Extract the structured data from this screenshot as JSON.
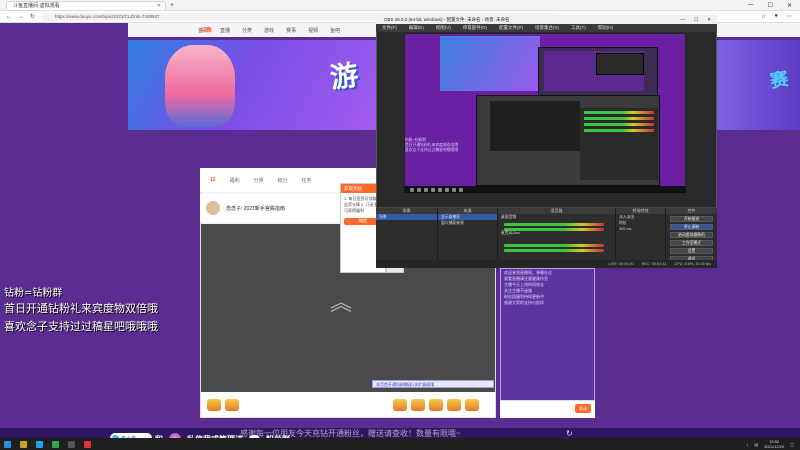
{
  "browser": {
    "tab_title": "斗鱼直播间·虚拟观看",
    "url": "https://www.douyu.com/topic/2021/CLZ/rid=7428937",
    "window_controls": [
      "—",
      "☐",
      "✕"
    ]
  },
  "site": {
    "logo": "斗鱼",
    "nav": [
      "首页",
      "直播",
      "分类",
      "游戏",
      "赛事",
      "视频",
      "鱼吧"
    ],
    "banner_text": "游",
    "banner_right_text": "赛"
  },
  "room": {
    "header_items": [
      "12",
      "福利",
      "分类",
      "积分",
      "任务"
    ],
    "title": "念念子: 2021新手宫殿指南",
    "popup_title": "获取奖励",
    "popup_text": "1. 每日签到可领取粉丝荧光棒 2. 订阅主播可获得福利",
    "popup_button": "确定",
    "notice": "本月首开通钻粉赠送1次扩展权限",
    "chat_lines": [
      "欢迎来到直播间，弹幕礼仪",
      "观看直播请注意健康作息",
      "主播今天上线时间较长",
      "关注主播不迷路",
      "粉丝团福利持续更新中",
      "感谢大家的支持与陪伴"
    ],
    "chat_send": "发送"
  },
  "obs": {
    "title": "OBS 26.0.2 (64-bit, windows) - 配置文件: 未命名 - 场景: 未命名",
    "menu": [
      "文件(F)",
      "编辑(E)",
      "视图(V)",
      "停靠部件(D)",
      "配置文件(P)",
      "场景集合(S)",
      "工具(T)",
      "帮助(H)"
    ],
    "preview_text": [
      "钻粉=钻粉群",
      "首日开通钻粉礼来宾度物双倍哦",
      "喜欢念子支持过过稿星吧哦哦哦"
    ],
    "dock_headers": [
      "场景",
      "来源",
      "混音器",
      "转场特效",
      "控件"
    ],
    "sources": [
      "显示器捕获",
      "窗口捕获来源"
    ],
    "mixer_labels": [
      "桌面音频",
      "麦克风/Aux"
    ],
    "transition": [
      "淡入淡出",
      "时长",
      "300 ms"
    ],
    "controls": [
      "开始推流",
      "停止录制",
      "启动虚拟摄像机",
      "工作室模式",
      "设置",
      "退出"
    ],
    "status": [
      "LIVE: 00:00:00",
      "REC: 00:04:31",
      "CPU: 8.6%, 30.00 fps"
    ]
  },
  "overlay": {
    "line1": "钻粉=钻粉群",
    "line2": "首日开通钻粉礼来宾度物双倍哦",
    "line3": "喜欢念子支持过过稿星吧哦哦哦"
  },
  "bottom": {
    "scroll_notice": "感谢每一位朋友今天充钻开通粉丝，赠送请查收！数量有限哦~",
    "pill": "念小念",
    "promo_and": "和",
    "promo_text": "私信我或管理进",
    "promo_group": "粉丝群"
  },
  "taskbar": {
    "time": "19:52",
    "date": "2021/12/20"
  },
  "colors": {
    "background": "#5b2d91",
    "accent": "#ff6a2a",
    "obs_dark": "#2a2a2a"
  }
}
